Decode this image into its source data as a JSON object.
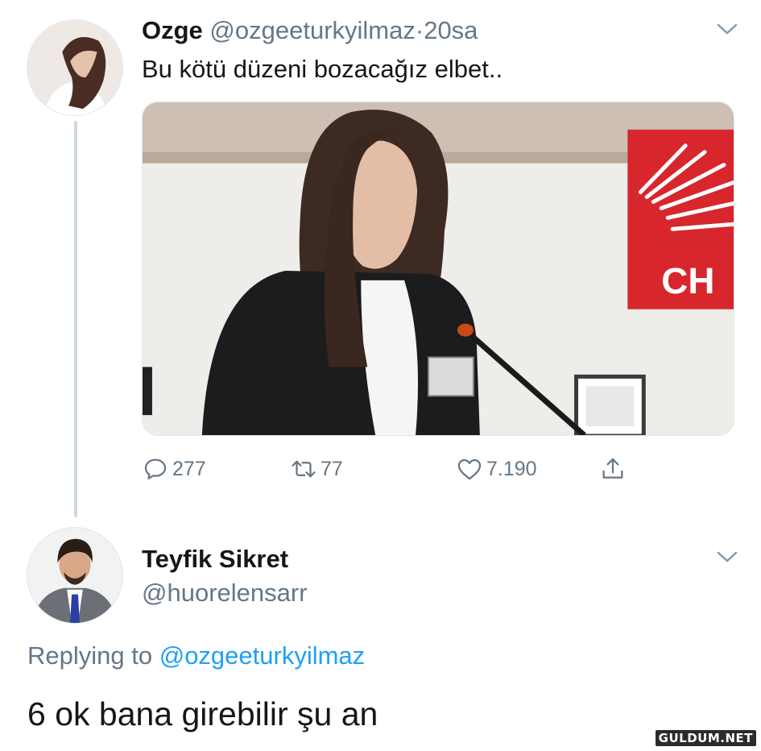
{
  "tweet": {
    "author_name": "Ozge",
    "author_handle": "@ozgeeturkyilmaz",
    "separator": "·",
    "time": "20sa",
    "text": "Bu kötü düzeni bozacağız elbet..",
    "media_sign_text": "CH",
    "stats": {
      "replies": "277",
      "retweets": "77",
      "likes": "7.190"
    }
  },
  "reply": {
    "author_name": "Teyfik Sikret",
    "author_handle": "@huorelensarr",
    "replying_prefix": "Replying to",
    "replying_to": "@ozgeeturkyilmaz",
    "text": "6 ok bana girebilir şu an"
  },
  "watermark": "GULDUM.NET",
  "colors": {
    "text_primary": "#14171a",
    "text_secondary": "#657786",
    "link": "#1da1f2",
    "thread_line": "#cfd9de",
    "flag_red": "#d7262c"
  },
  "icons": [
    "chevron-down-icon",
    "reply-icon",
    "retweet-icon",
    "like-icon",
    "share-icon"
  ]
}
